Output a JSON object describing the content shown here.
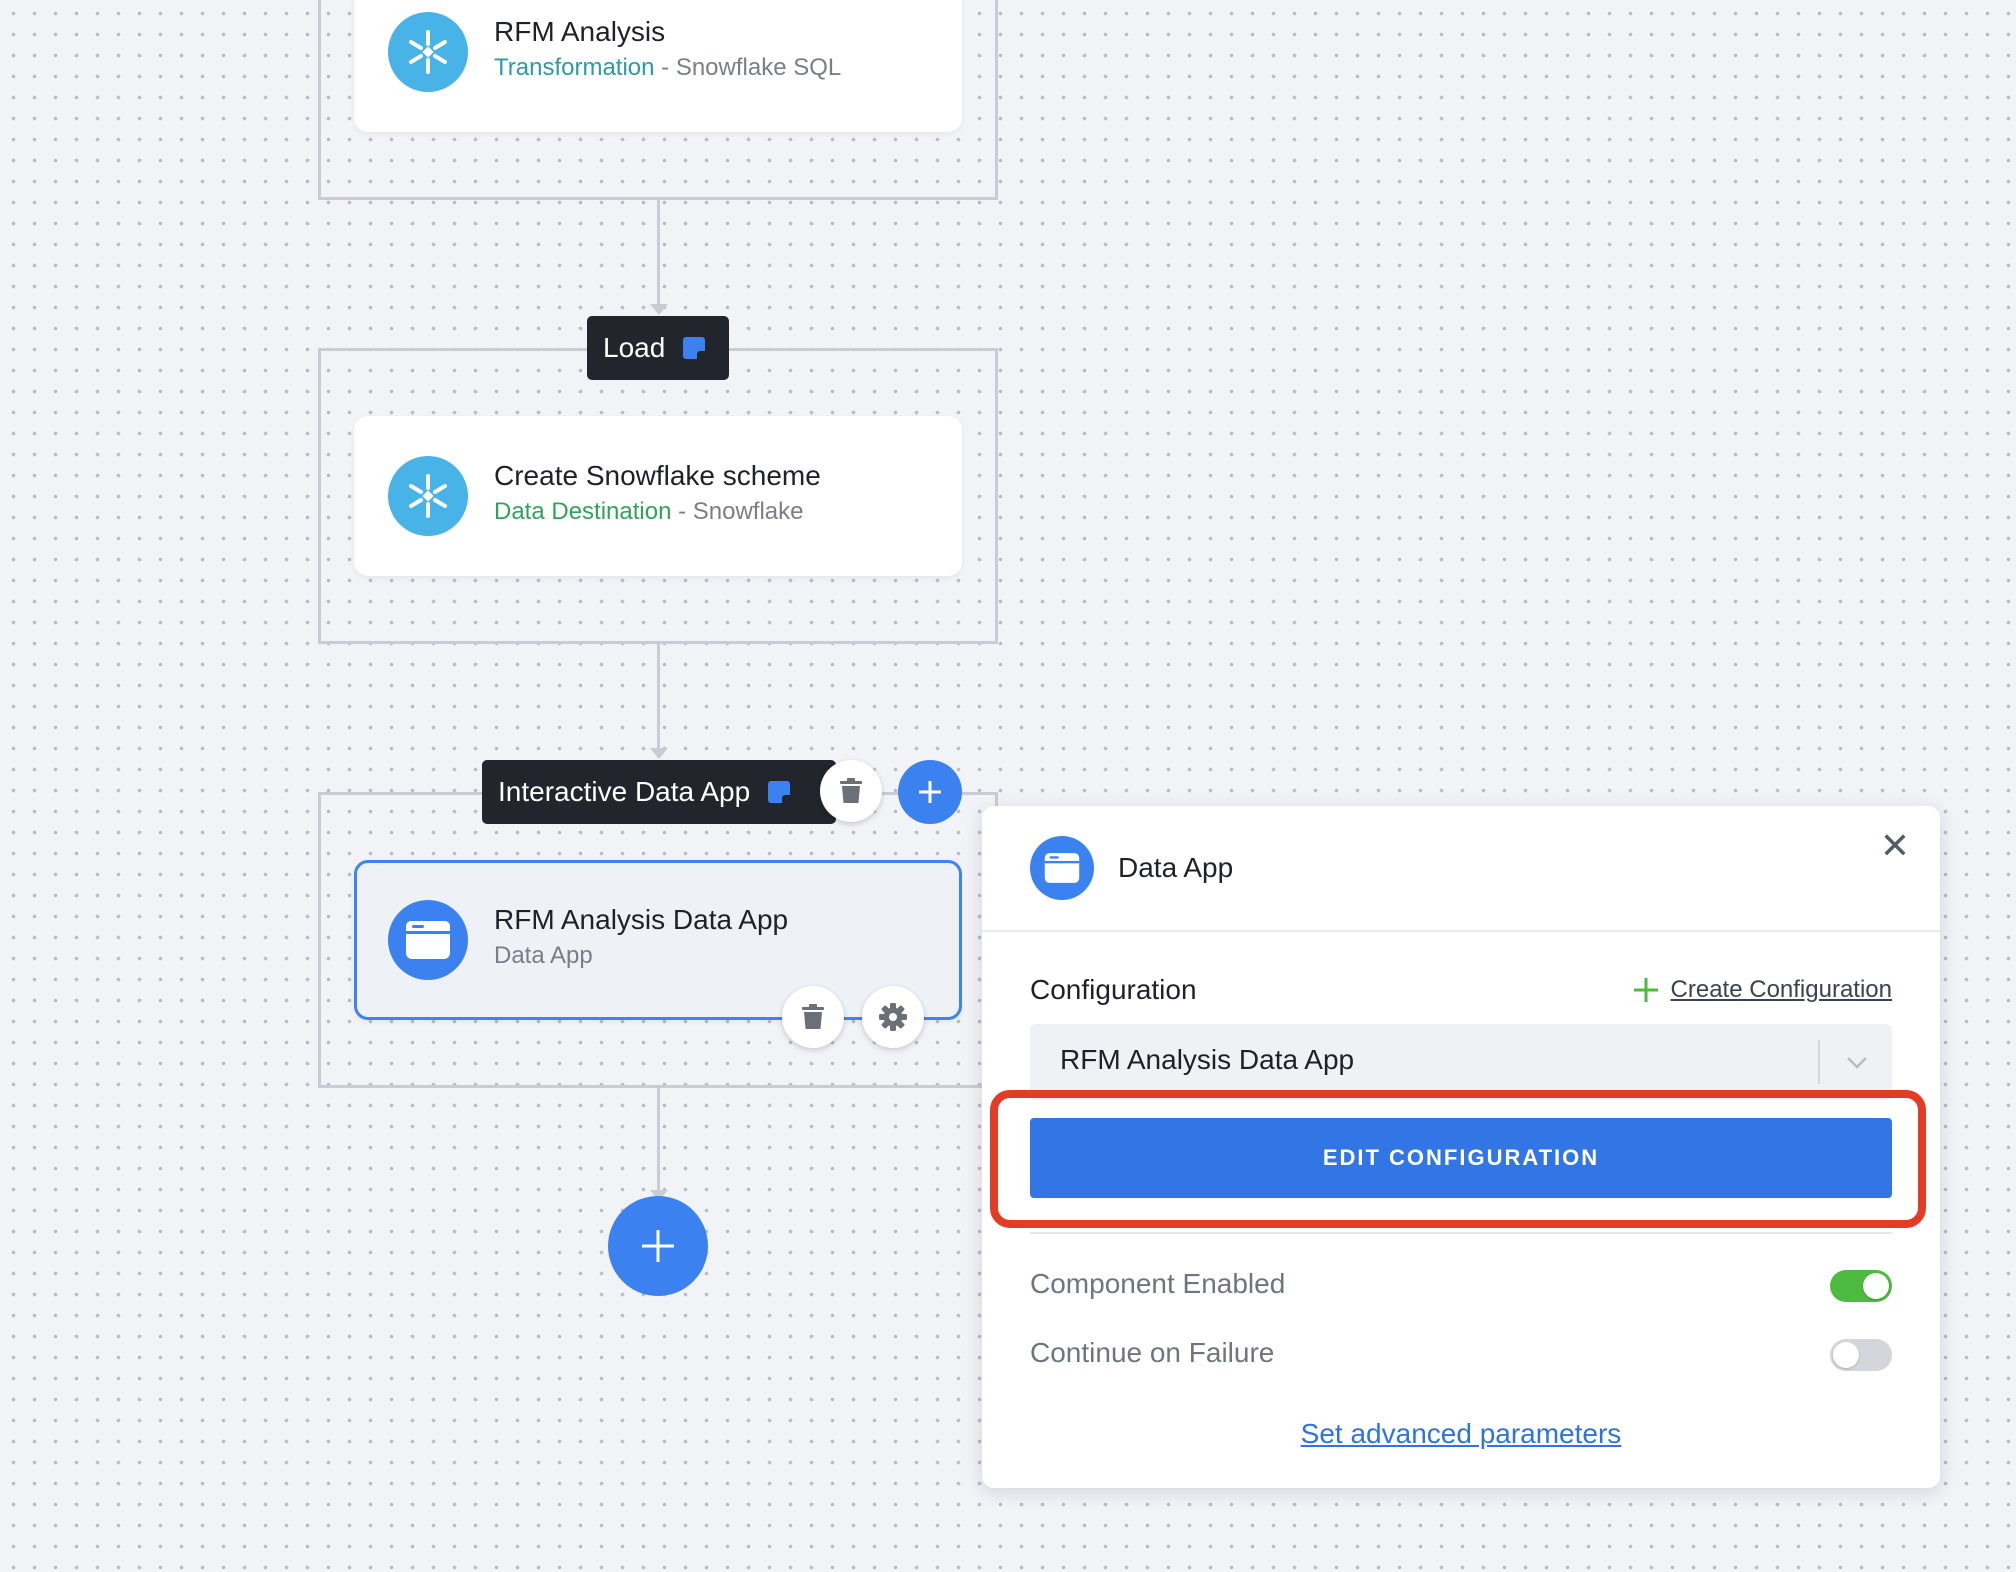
{
  "flow": {
    "phases": [
      {
        "tasks": [
          {
            "title": "RFM Analysis",
            "type": "Transformation",
            "separator": " - ",
            "component": "Snowflake SQL",
            "icon": "snowflake-icon"
          }
        ]
      },
      {
        "label": "Load",
        "tasks": [
          {
            "title": "Create Snowflake scheme",
            "type": "Data Destination",
            "separator": " - ",
            "component": "Snowflake",
            "icon": "snowflake-icon"
          }
        ]
      },
      {
        "label": "Interactive Data App",
        "tasks": [
          {
            "title": "RFM Analysis Data App",
            "subtitle": "Data App",
            "icon": "app-window-icon",
            "selected": true
          }
        ]
      }
    ]
  },
  "panel": {
    "title": "Data App",
    "close_icon": "close-icon",
    "configuration_label": "Configuration",
    "create_configuration_link": "Create Configuration",
    "selected_configuration": "RFM Analysis Data App",
    "edit_button": "EDIT CONFIGURATION",
    "toggles": [
      {
        "label": "Component Enabled",
        "on": true
      },
      {
        "label": "Continue on Failure",
        "on": false
      }
    ],
    "advanced_link": "Set advanced parameters"
  },
  "colors": {
    "accent": "#3b82f0",
    "primary_button": "#3276e6",
    "highlight": "#e23b26",
    "toggle_on": "#4cbb3f",
    "toggle_off": "#d4d6db",
    "snowflake": "#47b3e6"
  }
}
